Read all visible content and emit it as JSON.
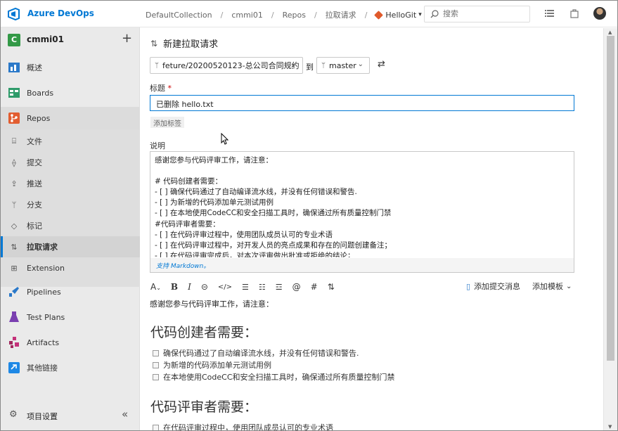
{
  "app": {
    "brand": "Azure DevOps"
  },
  "breadcrumb": [
    "DefaultCollection",
    "cmmi01",
    "Repos",
    "拉取请求"
  ],
  "repo_name": "HelloGit",
  "search": {
    "placeholder": "搜索"
  },
  "project": {
    "badge": "C",
    "name": "cmmi01"
  },
  "nav": {
    "overview": "概述",
    "boards": "Boards",
    "repos": "Repos",
    "files": "文件",
    "commits": "提交",
    "pushes": "推送",
    "branches": "分支",
    "tags": "标记",
    "pull_requests": "拉取请求",
    "extension": "Extension",
    "pipelines": "Pipelines",
    "test_plans": "Test Plans",
    "artifacts": "Artifacts",
    "other_links": "其他链接",
    "project_settings": "项目设置"
  },
  "page": {
    "title": "新建拉取请求",
    "source_branch": "feture/20200520123-总公司合同规约",
    "to_label": "到",
    "target_branch": "master",
    "title_label": "标题",
    "title_required": "*",
    "title_value": "已删除 hello.txt",
    "add_tag": "添加标签",
    "description_label": "说明",
    "description_text": "感谢您参与代码评审工作，请注意：\n\n# 代码创建者需要：\n- [ ] 确保代码通过了自动编译流水线，并没有任何错误和警告.\n- [ ] 为新增的代码添加单元测试用例\n- [ ] 在本地使用CodeCC和安全扫描工具时，确保通过所有质量控制门禁\n#代码评审者需要：\n- [ ] 在代码评审过程中，使用团队成员认可的专业术语\n- [ ] 在代码评审过程中，对开发人员的亮点成果和存在的问题创建备注；\n- [ ] 在代码评审完成后，对本次评审做出批准或拒绝的结论；",
    "markdown_hint": "支持 Markdown。",
    "add_commit_messages": "添加提交消息",
    "add_template": "添加模板"
  },
  "preview": {
    "intro": "感谢您参与代码评审工作，请注意：",
    "heading1": "代码创建者需要：",
    "creator_items": [
      "确保代码通过了自动编译流水线，并没有任何错误和警告.",
      "为新增的代码添加单元测试用例",
      "在本地使用CodeCC和安全扫描工具时，确保通过所有质量控制门禁"
    ],
    "heading2": "代码评审者需要：",
    "reviewer_items": [
      "在代码评审过程中，使用团队成员认可的专业术语"
    ]
  },
  "colors": {
    "accent": "#0078d4",
    "sidebar_bg": "#eaeaea",
    "project_badge": "#339947"
  }
}
